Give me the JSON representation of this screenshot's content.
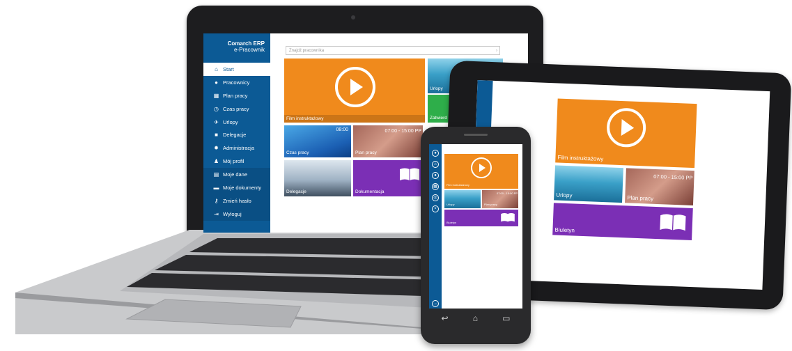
{
  "colors": {
    "orange": "#f08a1c",
    "purple": "#7b2fb5",
    "green": "#2eae4a",
    "blue": "#0c5a95"
  },
  "laptop": {
    "brand_line1": "Comarch ERP",
    "brand_line2": "e-Pracownik",
    "search_placeholder": "Znajdź pracownika",
    "nav": [
      {
        "label": "Start",
        "icon": "home-icon"
      },
      {
        "label": "Pracownicy",
        "icon": "users-icon"
      },
      {
        "label": "Plan pracy",
        "icon": "calendar-icon"
      },
      {
        "label": "Czas pracy",
        "icon": "clock-icon"
      },
      {
        "label": "Urlopy",
        "icon": "plane-icon"
      },
      {
        "label": "Delegacje",
        "icon": "briefcase-icon"
      },
      {
        "label": "Administracja",
        "icon": "gear-icon"
      },
      {
        "label": "Mój profil",
        "icon": "profile-icon"
      },
      {
        "label": "Moje dane",
        "icon": "id-card-icon"
      },
      {
        "label": "Moje dokumenty",
        "icon": "documents-icon"
      },
      {
        "label": "Zmień hasło",
        "icon": "key-icon"
      },
      {
        "label": "Wyloguj",
        "icon": "logout-icon"
      }
    ],
    "tiles": {
      "film": "Film instruktażowy",
      "urlopy": "Urlopy",
      "zatwierdz": "Zatwierd",
      "czas_pracy": "Czas pracy",
      "czas_time": "08:00",
      "plan_pracy": "Plan pracy",
      "plan_time": "07:00 - 15:00 PP",
      "delegacje": "Delegacje",
      "dokumentacja": "Dokumentacja"
    }
  },
  "tablet": {
    "film": "Film instruktażowy",
    "urlopy": "Urlopy",
    "plan_pracy": "Plan pracy",
    "plan_time": "07:00 - 15:00 PP",
    "biuletyn": "Biuletyn"
  },
  "phone": {
    "film": "Film instruktażowy",
    "urlopy": "Urlopy",
    "plan_pracy": "Plan pracy",
    "plan_time": "07:00 - 15:00 PP",
    "biuletyn": "Biuletyn"
  }
}
